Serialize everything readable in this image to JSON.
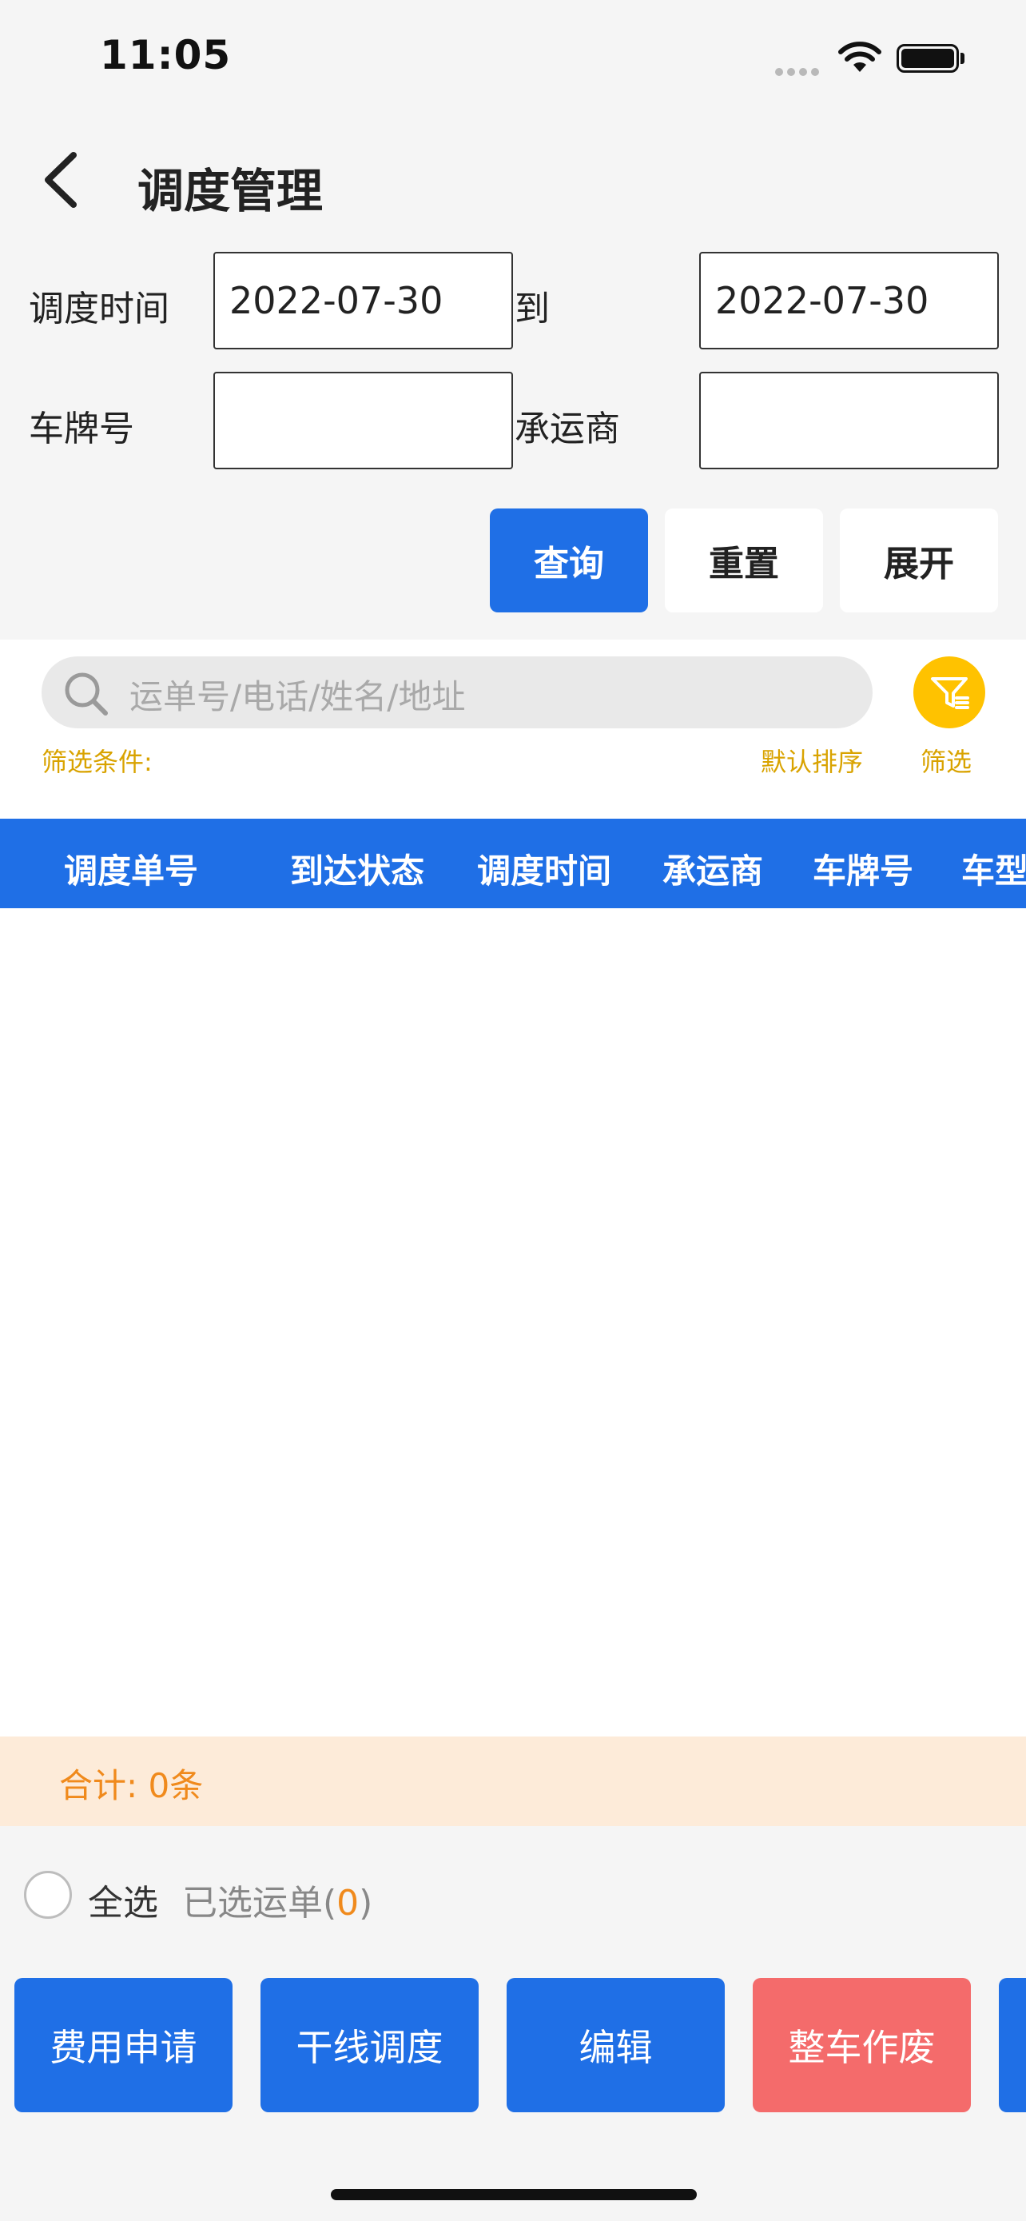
{
  "status": {
    "time": "11:05"
  },
  "header": {
    "title": "调度管理"
  },
  "form": {
    "dispatch_time_label": "调度时间",
    "date_from": "2022-07-30",
    "to_label": "到",
    "date_to": "2022-07-30",
    "plate_label": "车牌号",
    "plate_value": "",
    "carrier_label": "承运商",
    "carrier_value": ""
  },
  "buttons": {
    "query": "查询",
    "reset": "重置",
    "expand": "展开"
  },
  "search": {
    "placeholder": "运单号/电话/姓名/地址"
  },
  "filter": {
    "conditions_label": "筛选条件:",
    "sort_label": "默认排序",
    "filter_label": "筛选"
  },
  "table": {
    "columns": [
      "调度单号",
      "到达状态",
      "调度时间",
      "承运商",
      "车牌号",
      "车型"
    ],
    "rows": []
  },
  "total": {
    "text": "合计: 0条"
  },
  "selection": {
    "select_all": "全选",
    "selected_label": "已选运单(",
    "selected_count": "0",
    "selected_suffix": ")"
  },
  "actions": [
    "费用申请",
    "干线调度",
    "编辑",
    "整车作废"
  ],
  "colors": {
    "primary": "#1f6fe6",
    "danger": "#f46b6b",
    "accent": "#ffc200",
    "total_bg": "#fdebd9"
  }
}
